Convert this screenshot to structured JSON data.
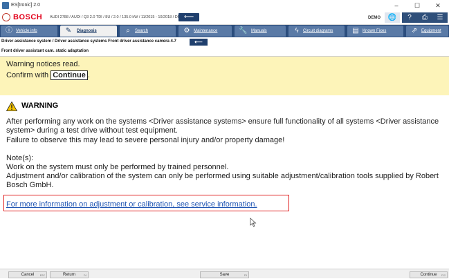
{
  "window": {
    "title": "ES[tronic] 2.0",
    "controls": [
      "–",
      "☐",
      "✕"
    ]
  },
  "header": {
    "brand": "BOSCH",
    "vehicle": "AUDI 2788 / AUDI / Q3 2.0 TDI / 8U / 2.0 / 135.0 kW / 11/2015 - 10/2018 / DFUA",
    "mode": "DEMO"
  },
  "nav": {
    "tabs": [
      {
        "label": "Vehicle info"
      },
      {
        "label": "Diagnosis"
      },
      {
        "label": "Search"
      },
      {
        "label": "Maintenance"
      },
      {
        "label": "Manuals"
      },
      {
        "label": "Circuit diagrams"
      },
      {
        "label": "Known Fixes"
      },
      {
        "label": "Equipment"
      }
    ]
  },
  "breadcrumb": {
    "path": "Driver assistance system / Driver assistance systems Front driver assistance camera 4.7",
    "subtitle": "Front driver assistant cam. static adaptation"
  },
  "notice": {
    "line1": "Warning notices read.",
    "line2_prefix": "Confirm with ",
    "line2_button": "Continue",
    "line2_suffix": "."
  },
  "warning": {
    "heading": "WARNING",
    "paragraph1": "After performing any work on the systems <Driver assistance systems> ensure full functionality of all systems <Driver assistance system> during a test drive without test equipment.",
    "paragraph2": "Failure to observe this may lead to severe personal injury and/or property damage!",
    "notes_label": "Note(s):",
    "note1": "Work on the system must only be performed by trained personnel.",
    "note2": "Adjustment and/or calibration of the system can only be performed using suitable adjustment/calibration tools supplied by Robert Bosch GmbH."
  },
  "link": {
    "text": "For more information on adjustment or calibration, see service information."
  },
  "footer": {
    "cancel": "Cancel",
    "cancel_key": "ESC",
    "return": "Return",
    "return_key": "F4",
    "save": "Save",
    "save_key": "F5",
    "continue": "Continue",
    "continue_key": "F12"
  },
  "colors": {
    "nav": "#2b4d7d",
    "notice_bg": "#fdf4b9",
    "brand_red": "#e2001a",
    "link": "#1f55b3",
    "highlight": "#e02020"
  }
}
